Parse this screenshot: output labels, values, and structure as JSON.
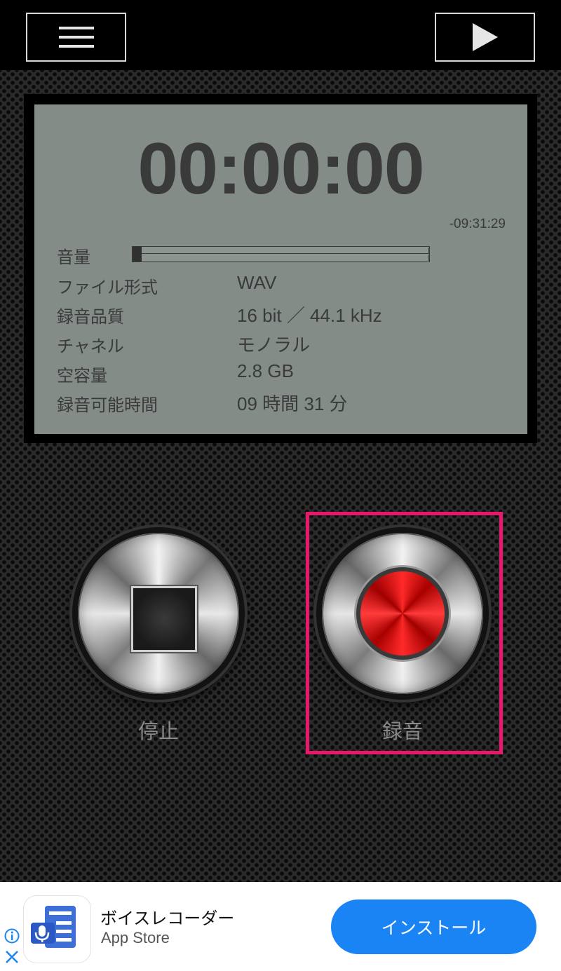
{
  "header": {
    "menu_icon": "hamburger-menu-icon",
    "play_icon": "play-icon"
  },
  "display": {
    "elapsed_time": "00:00:00",
    "remaining_time": "-09:31:29",
    "volume_label": "音量",
    "volume_level": 0.03,
    "rows": [
      {
        "label": "ファイル形式",
        "value": "WAV"
      },
      {
        "label": "録音品質",
        "value": "16 bit ／ 44.1 kHz"
      },
      {
        "label": "チャネル",
        "value": "モノラル"
      },
      {
        "label": "空容量",
        "value": "2.8 GB"
      },
      {
        "label": "録音可能時間",
        "value": "09 時間 31 分"
      }
    ]
  },
  "controls": {
    "stop_label": "停止",
    "stop_icon": "stop-square-icon",
    "record_label": "録音",
    "record_icon": "record-dot-icon",
    "highlight_color": "#e8186c",
    "record_color": "#e00000"
  },
  "ad": {
    "app_name": "ボイスレコーダー",
    "store": "App Store",
    "install_label": "インストール",
    "install_color": "#1a84f5",
    "info_icon": "info-icon",
    "close_icon": "close-icon",
    "app_icon": "voice-recorder-app-icon"
  }
}
